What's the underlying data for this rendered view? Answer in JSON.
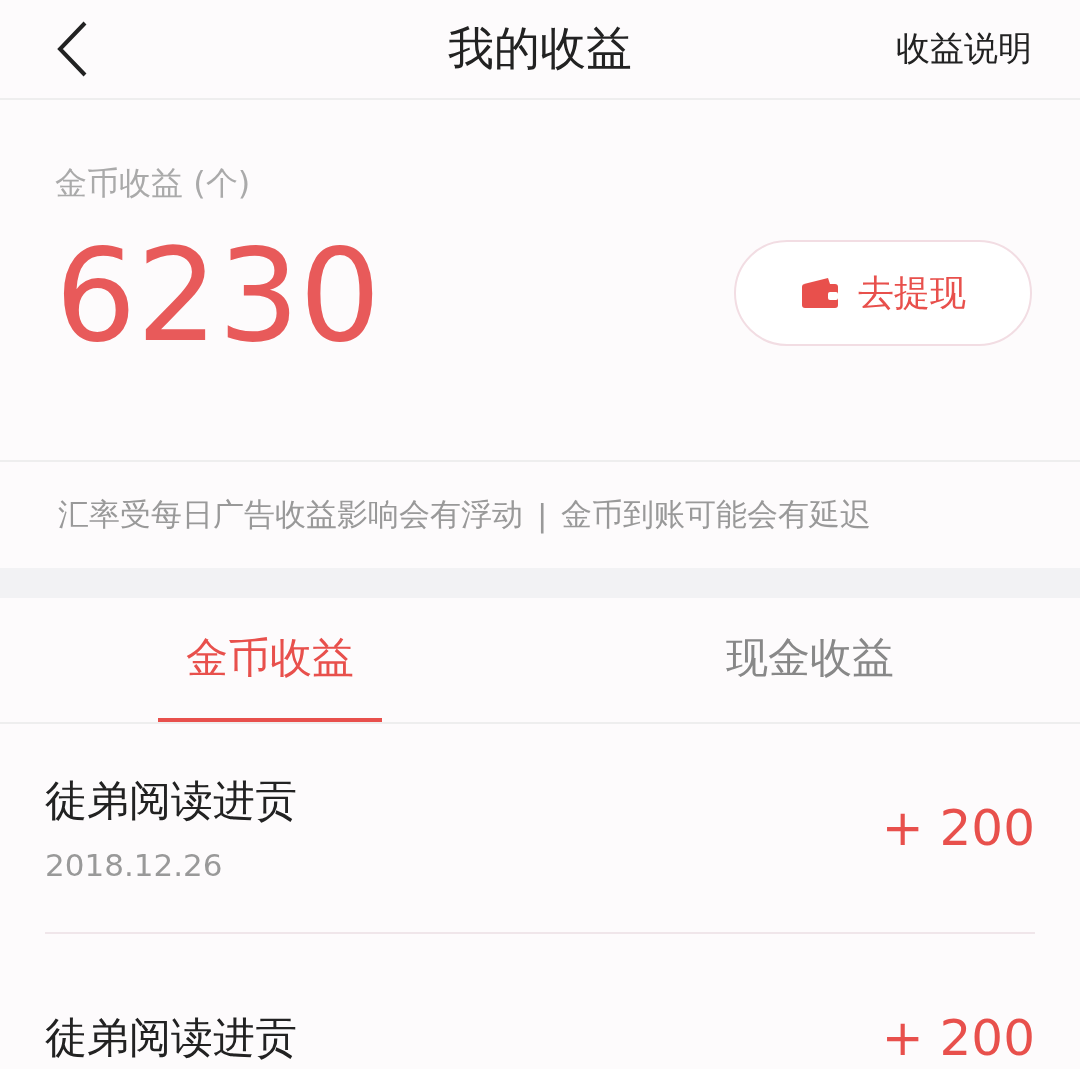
{
  "header": {
    "title": "我的收益",
    "action": "收益说明"
  },
  "summary": {
    "label": "金币收益 (个)",
    "amount": "6230",
    "withdraw_button": "去提现"
  },
  "notice": {
    "left": "汇率受每日广告收益影响会有浮动",
    "separator": "|",
    "right": "金币到账可能会有延迟"
  },
  "tabs": [
    {
      "label": "金币收益",
      "selected": true
    },
    {
      "label": "现金收益",
      "selected": false
    }
  ],
  "records": [
    {
      "title": "徒弟阅读进贡",
      "date": "2018.12.26",
      "amount": "+ 200"
    },
    {
      "title": "徒弟阅读进贡",
      "amount": "+ 200"
    }
  ]
}
